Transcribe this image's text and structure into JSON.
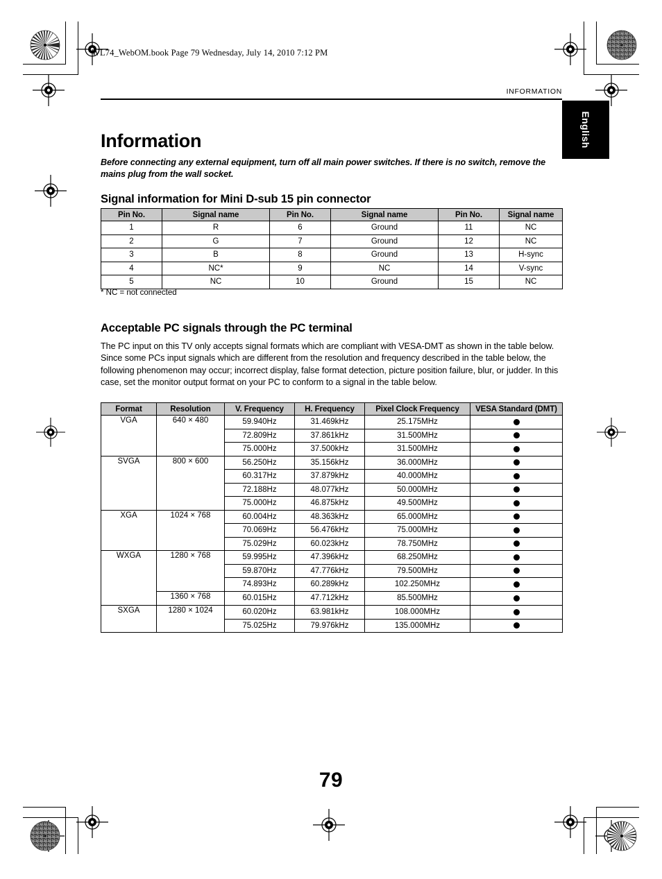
{
  "slug": "WL74_WebOM.book  Page 79  Wednesday, July 14, 2010  7:12 PM",
  "running_head": "INFORMATION",
  "language_tab": "English",
  "chapter_title": "Information",
  "lead_note": "Before connecting any external equipment, turn off all main power switches. If there is no switch, remove the mains plug from the wall socket.",
  "heading_signal": "Signal information for Mini D-sub 15 pin connector",
  "footnote": "* NC = not connected",
  "heading_acceptable": "Acceptable PC signals through the PC terminal",
  "body_paragraph": "The PC input on this TV only accepts signal formats which are compliant with VESA-DMT as shown in the table below. Since some PCs input signals which are different from the resolution and frequency described in the table below, the following phenomenon may occur; incorrect display, false format detection, picture position failure, blur, or judder. In this case, set the monitor output format on your PC to conform to a signal in the table below.",
  "folio": "79",
  "pin_table": {
    "headers": [
      "Pin No.",
      "Signal name",
      "Pin No.",
      "Signal name",
      "Pin No.",
      "Signal name"
    ],
    "rows": [
      [
        "1",
        "R",
        "6",
        "Ground",
        "11",
        "NC"
      ],
      [
        "2",
        "G",
        "7",
        "Ground",
        "12",
        "NC"
      ],
      [
        "3",
        "B",
        "8",
        "Ground",
        "13",
        "H-sync"
      ],
      [
        "4",
        "NC*",
        "9",
        "NC",
        "14",
        "V-sync"
      ],
      [
        "5",
        "NC",
        "10",
        "Ground",
        "15",
        "NC"
      ]
    ]
  },
  "signal_table": {
    "headers": [
      "Format",
      "Resolution",
      "V. Frequency",
      "H. Frequency",
      "Pixel Clock Frequency",
      "VESA Standard (DMT)"
    ],
    "rows": [
      {
        "format": "VGA",
        "resolution": "640 × 480",
        "v_freq": "59.940Hz",
        "h_freq": "31.469kHz",
        "pixel_clock": "25.175MHz",
        "vesa": "●"
      },
      {
        "format": "",
        "resolution": "",
        "v_freq": "72.809Hz",
        "h_freq": "37.861kHz",
        "pixel_clock": "31.500MHz",
        "vesa": "●"
      },
      {
        "format": "",
        "resolution": "",
        "v_freq": "75.000Hz",
        "h_freq": "37.500kHz",
        "pixel_clock": "31.500MHz",
        "vesa": "●"
      },
      {
        "format": "SVGA",
        "resolution": "800 × 600",
        "v_freq": "56.250Hz",
        "h_freq": "35.156kHz",
        "pixel_clock": "36.000MHz",
        "vesa": "●"
      },
      {
        "format": "",
        "resolution": "",
        "v_freq": "60.317Hz",
        "h_freq": "37.879kHz",
        "pixel_clock": "40.000MHz",
        "vesa": "●"
      },
      {
        "format": "",
        "resolution": "",
        "v_freq": "72.188Hz",
        "h_freq": "48.077kHz",
        "pixel_clock": "50.000MHz",
        "vesa": "●"
      },
      {
        "format": "",
        "resolution": "",
        "v_freq": "75.000Hz",
        "h_freq": "46.875kHz",
        "pixel_clock": "49.500MHz",
        "vesa": "●"
      },
      {
        "format": "XGA",
        "resolution": "1024 × 768",
        "v_freq": "60.004Hz",
        "h_freq": "48.363kHz",
        "pixel_clock": "65.000MHz",
        "vesa": "●"
      },
      {
        "format": "",
        "resolution": "",
        "v_freq": "70.069Hz",
        "h_freq": "56.476kHz",
        "pixel_clock": "75.000MHz",
        "vesa": "●"
      },
      {
        "format": "",
        "resolution": "",
        "v_freq": "75.029Hz",
        "h_freq": "60.023kHz",
        "pixel_clock": "78.750MHz",
        "vesa": "●"
      },
      {
        "format": "WXGA",
        "resolution": "1280 × 768",
        "v_freq": "59.995Hz",
        "h_freq": "47.396kHz",
        "pixel_clock": "68.250MHz",
        "vesa": "●"
      },
      {
        "format": "",
        "resolution": "",
        "v_freq": "59.870Hz",
        "h_freq": "47.776kHz",
        "pixel_clock": "79.500MHz",
        "vesa": "●"
      },
      {
        "format": "",
        "resolution": "",
        "v_freq": "74.893Hz",
        "h_freq": "60.289kHz",
        "pixel_clock": "102.250MHz",
        "vesa": "●"
      },
      {
        "format": "",
        "resolution": "1360 × 768",
        "v_freq": "60.015Hz",
        "h_freq": "47.712kHz",
        "pixel_clock": "85.500MHz",
        "vesa": "●"
      },
      {
        "format": "SXGA",
        "resolution": "1280 × 1024",
        "v_freq": "60.020Hz",
        "h_freq": "63.981kHz",
        "pixel_clock": "108.000MHz",
        "vesa": "●"
      },
      {
        "format": "",
        "resolution": "",
        "v_freq": "75.025Hz",
        "h_freq": "79.976kHz",
        "pixel_clock": "135.000MHz",
        "vesa": "●"
      }
    ]
  }
}
